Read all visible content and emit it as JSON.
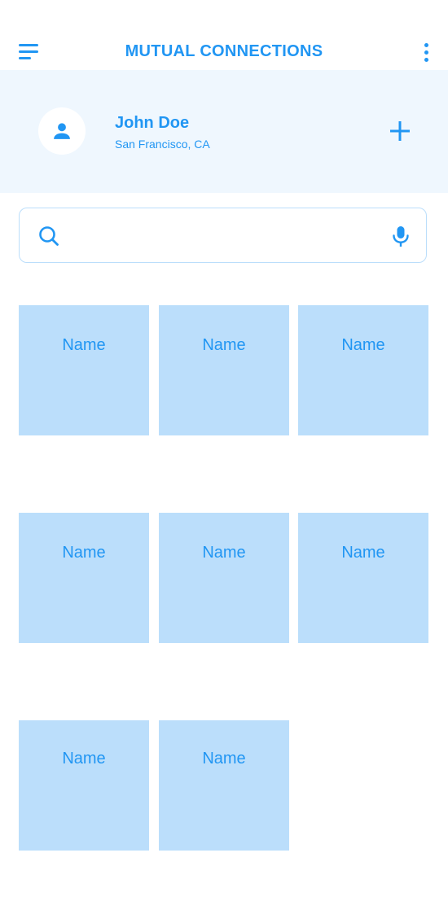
{
  "header": {
    "title": "MUTUAL CONNECTIONS",
    "menu_icon": "hamburger-menu-icon",
    "more_icon": "more-vertical-icon"
  },
  "profile": {
    "name": "John Doe",
    "location": "San Francisco, CA",
    "avatar_icon": "person-icon",
    "add_icon": "plus-icon"
  },
  "search": {
    "placeholder": "",
    "value": "",
    "search_icon": "search-icon",
    "voice_icon": "microphone-icon"
  },
  "connections": [
    {
      "name": "Name"
    },
    {
      "name": "Name"
    },
    {
      "name": "Name"
    },
    {
      "name": "Name"
    },
    {
      "name": "Name"
    },
    {
      "name": "Name"
    },
    {
      "name": "Name"
    },
    {
      "name": "Name"
    }
  ],
  "colors": {
    "accent": "#2196f3",
    "panel_background": "#eff7fe",
    "card_background": "#bbdefb"
  }
}
